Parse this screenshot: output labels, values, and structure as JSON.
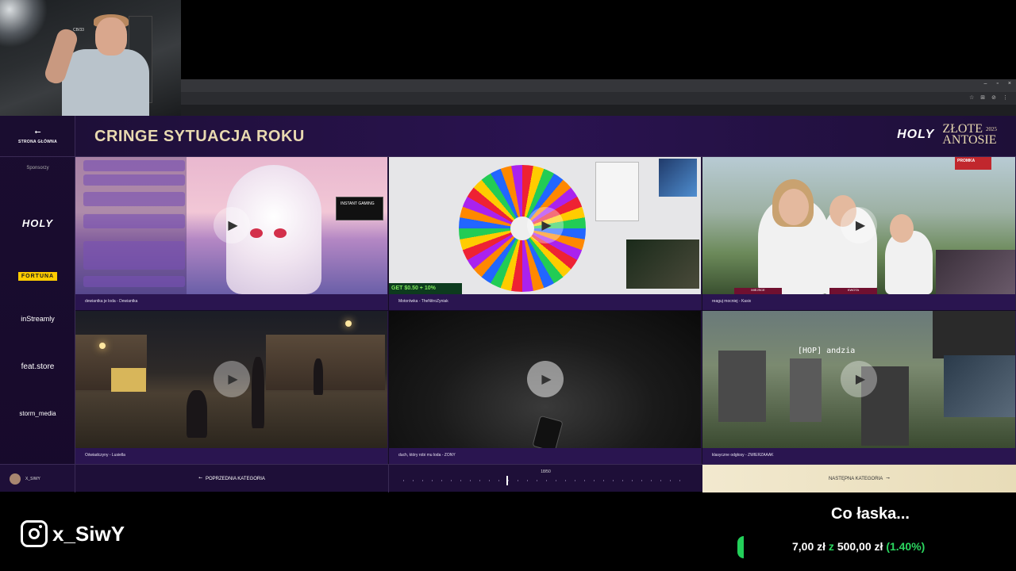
{
  "webcam": {
    "badge": "CB/33"
  },
  "browser": {
    "controls": [
      "–",
      "▫",
      "×"
    ],
    "tools": [
      "☆",
      "⊞",
      "⊘",
      "⋮"
    ]
  },
  "sidebar": {
    "home_label": "STRONA GŁÓWNA",
    "sponsors_label": "Sponsorzy",
    "sponsors": [
      "HOLY",
      "FORTUNA",
      "inStreamly",
      "feat.store",
      "storm_media"
    ]
  },
  "header": {
    "title": "CRINGE SYTUACJA ROKU",
    "brand_holy": "HOLY",
    "brand_line1": "ZŁOTE",
    "brand_line2": "ANTOSIE",
    "brand_year": "2025"
  },
  "tiles": [
    {
      "caption": "dewiantka je loda - Dewiantka",
      "logo": "INSTANT GAMING"
    },
    {
      "caption": "Motorówka - TheNitroZyniak",
      "promo": "GET $0.50 + 10%"
    },
    {
      "caption": "reaguj mocniej - Kasix",
      "promo": "PROMKA",
      "bar1": "MIEJSCE",
      "bar2": "KWOTA"
    },
    {
      "caption": "Oświadczyny - Lusiella"
    },
    {
      "caption": "duch, który robi mu loda - ZONY"
    },
    {
      "caption": "klasyczne odgłosy - ZWIERZAAAK",
      "tag": "[HOP] andzia"
    }
  ],
  "footer": {
    "user": "X_SIWY",
    "prev": "POPRZEDNIA KATEGORIA",
    "progress": "18/50",
    "progress_fraction": 0.36,
    "next": "NASTĘPNA KATEGORIA"
  },
  "overlay": {
    "instagram": "x_SiwY",
    "goal_title": "Co łaska...",
    "goal_current": "7,00 zł",
    "goal_of": "z",
    "goal_target": "500,00 zł",
    "goal_pct": "(1.40%)",
    "goal_fraction": 0.014
  },
  "colors": {
    "accent_gold": "#e8d9b0",
    "goal_green": "#2bd55f",
    "panel_purple": "#1e0f38"
  }
}
